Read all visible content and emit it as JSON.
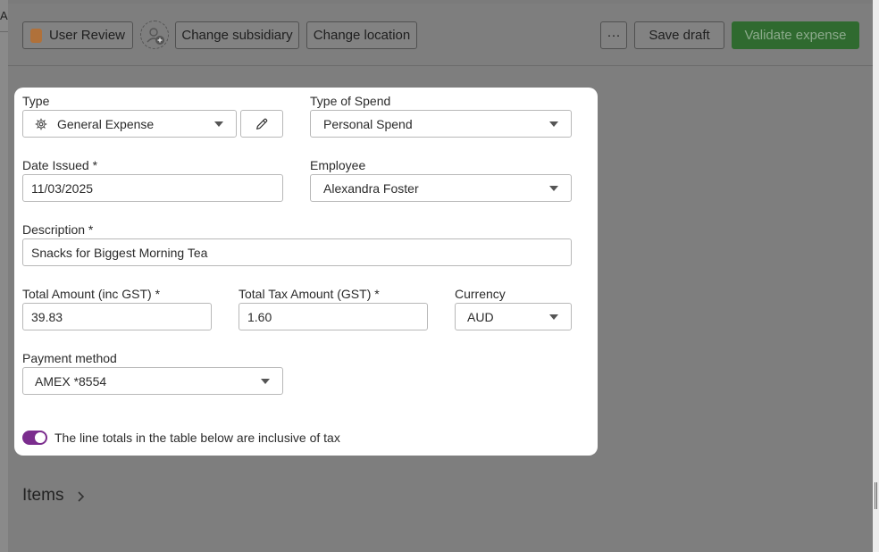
{
  "left_strip": {
    "fragment": "A"
  },
  "toolbar": {
    "user_review_label": "User Review",
    "change_subsidiary_label": "Change subsidiary",
    "change_location_label": "Change location",
    "more_label": "···",
    "save_draft_label": "Save draft",
    "validate_label": "Validate expense"
  },
  "form": {
    "type": {
      "label": "Type",
      "value": "General Expense"
    },
    "type_of_spend": {
      "label": "Type of Spend",
      "value": "Personal Spend"
    },
    "date_issued": {
      "label": "Date Issued *",
      "value": "11/03/2025"
    },
    "employee": {
      "label": "Employee",
      "value": "Alexandra Foster"
    },
    "description": {
      "label": "Description *",
      "value": "Snacks for Biggest Morning Tea"
    },
    "total_amount": {
      "label": "Total Amount (inc GST) *",
      "value": "39.83"
    },
    "total_tax": {
      "label": "Total Tax Amount (GST) *",
      "value": "1.60"
    },
    "currency": {
      "label": "Currency",
      "value": "AUD"
    },
    "payment_method": {
      "label": "Payment method",
      "value": "AMEX *8554"
    },
    "tax_inclusive_toggle": {
      "label": "The line totals in the table below are inclusive of tax",
      "on": true
    }
  },
  "items": {
    "title": "Items"
  },
  "colors": {
    "accent_toggle": "#7b2d8e",
    "validate_button": "#2f6a2f",
    "status_swatch": "#b0713a"
  },
  "icons": {
    "type_field": "gear-icon",
    "edit": "pencil-icon",
    "add_assignee": "add-user-icon",
    "items_expand": "chevron-right-icon"
  }
}
